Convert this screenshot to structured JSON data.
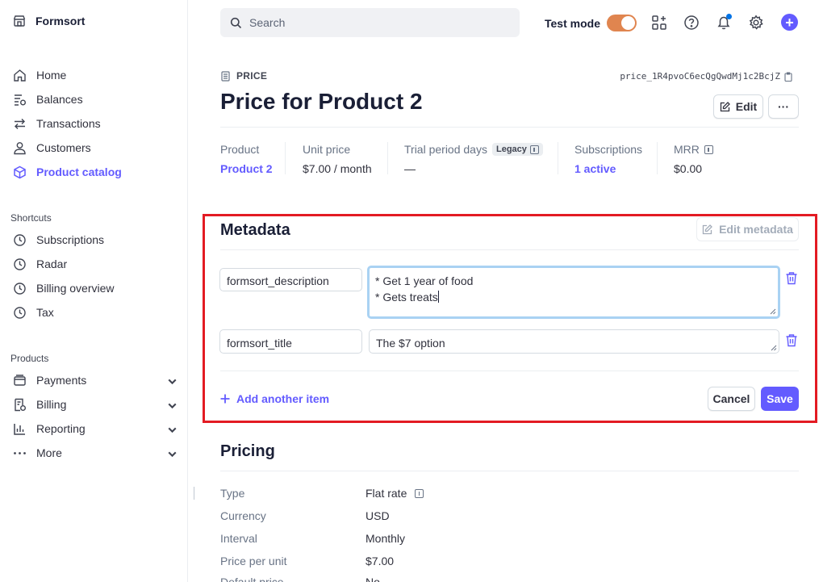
{
  "brand": {
    "name": "Formsort"
  },
  "sidebar": {
    "items": [
      {
        "label": "Home",
        "icon": "home-icon"
      },
      {
        "label": "Balances",
        "icon": "balances-icon"
      },
      {
        "label": "Transactions",
        "icon": "transactions-icon"
      },
      {
        "label": "Customers",
        "icon": "customers-icon"
      },
      {
        "label": "Product catalog",
        "icon": "product-catalog-icon",
        "active": true
      }
    ],
    "shortcuts_label": "Shortcuts",
    "shortcuts": [
      {
        "label": "Subscriptions",
        "icon": "clock-icon"
      },
      {
        "label": "Radar",
        "icon": "clock-icon"
      },
      {
        "label": "Billing overview",
        "icon": "clock-icon"
      },
      {
        "label": "Tax",
        "icon": "clock-icon"
      }
    ],
    "products_label": "Products",
    "products": [
      {
        "label": "Payments",
        "icon": "payments-icon"
      },
      {
        "label": "Billing",
        "icon": "billing-icon"
      },
      {
        "label": "Reporting",
        "icon": "reporting-icon"
      },
      {
        "label": "More",
        "icon": "more-dots-icon"
      }
    ]
  },
  "topbar": {
    "search_placeholder": "Search",
    "test_mode_label": "Test mode",
    "test_mode_on": true
  },
  "header": {
    "breadcrumb": "PRICE",
    "price_id": "price_1R4pvoC6ecQgQwdMj1c2BcjZ",
    "title": "Price for Product 2",
    "edit_label": "Edit",
    "more_label": "···"
  },
  "stats": [
    {
      "label": "Product",
      "value": "Product 2"
    },
    {
      "label": "Unit price",
      "value": "$7.00 / month"
    },
    {
      "label": "Trial period days",
      "badge": "Legacy",
      "value": "—"
    },
    {
      "label": "Subscriptions",
      "value": "1 active"
    },
    {
      "label": "MRR",
      "value": "$0.00"
    }
  ],
  "metadata": {
    "title": "Metadata",
    "edit_label": "Edit metadata",
    "items": [
      {
        "key": "formsort_description",
        "value_lines": [
          "* Get 1 year of food",
          "* Gets treats"
        ]
      },
      {
        "key": "formsort_title",
        "value_lines": [
          "The $7 option"
        ]
      }
    ],
    "add_label": "Add another item",
    "cancel_label": "Cancel",
    "save_label": "Save"
  },
  "pricing": {
    "title": "Pricing",
    "rows": [
      {
        "label": "Type",
        "value": "Flat rate"
      },
      {
        "label": "Currency",
        "value": "USD"
      },
      {
        "label": "Interval",
        "value": "Monthly"
      },
      {
        "label": "Price per unit",
        "value": "$7.00"
      },
      {
        "label": "Default price",
        "value": "No"
      }
    ]
  },
  "colors": {
    "accent": "#635bff",
    "highlight": "#e31b23",
    "toggle": "#e0854f"
  }
}
